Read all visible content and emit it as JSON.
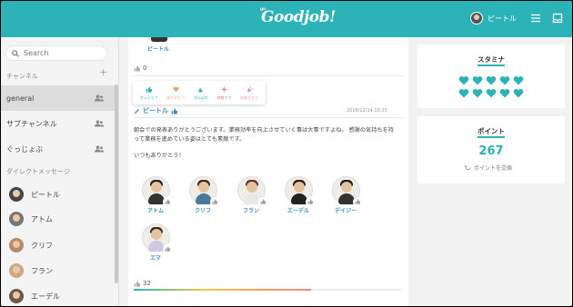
{
  "header": {
    "logo_top": "go",
    "logo": "Goodjob!",
    "user_name": "ピートル"
  },
  "sidebar": {
    "search_placeholder": "Search",
    "channels_label": "チャンネル",
    "channels": [
      {
        "label": "general",
        "active": true
      },
      {
        "label": "サブチャンネル",
        "active": false
      },
      {
        "label": "ぐっじょぶ",
        "active": false
      }
    ],
    "dm_label": "ダイレクトメッセージ",
    "dms": [
      {
        "label": "ピートル",
        "color": "#444"
      },
      {
        "label": "アトム",
        "color": "#777"
      },
      {
        "label": "クリフ",
        "color": "#b88a6a"
      },
      {
        "label": "フラン",
        "color": "#c9a98a"
      },
      {
        "label": "エーデル",
        "color": "#6d5a4a"
      }
    ]
  },
  "feed": {
    "prev_post_author": "ピートル",
    "prev_like_count": "0",
    "reactions": [
      {
        "label": "グッジョブ",
        "color": "#2bb3b8"
      },
      {
        "label": "ありがとう",
        "color": "#f5a35a"
      },
      {
        "label": "がんばれ",
        "color": "#2bb3b8"
      },
      {
        "label": "尊敬です",
        "color": "#ef8a8a"
      },
      {
        "label": "おめでとう",
        "color": "#ef8a8a"
      }
    ],
    "post": {
      "author": "ピートル",
      "date": "2018/12/14 10:25",
      "body_line1": "朝会での発表ありがとうございます。業務効率を向上させていく事は大事ですよね。 感謝の気持ちを持",
      "body_line2": "って業務を進めている姿はとても素敵です。",
      "body_line3": "いつもありがとう！",
      "recipients": [
        {
          "name": "アトム",
          "shirt": "#333",
          "hair": "#222"
        },
        {
          "name": "クリフ",
          "shirt": "#4a7a9a",
          "hair": "#3a2a1a"
        },
        {
          "name": "フラン",
          "shirt": "#fff",
          "hair": "#5a3a2a"
        },
        {
          "name": "エーデル",
          "shirt": "#222",
          "hair": "#2a1a10"
        },
        {
          "name": "デイジー",
          "shirt": "#333",
          "hair": "#1a1a1a"
        },
        {
          "name": "エマ",
          "shirt": "#d0c8e0",
          "hair": "#3a2820"
        }
      ],
      "like_count": "32",
      "progress_fraction": 0.66
    }
  },
  "stamina": {
    "title": "スタミナ",
    "hearts": 10,
    "heart_color": "#2bb3b8"
  },
  "points": {
    "title": "ポイント",
    "value": "267",
    "exchange_label": "ポイントを交換"
  }
}
